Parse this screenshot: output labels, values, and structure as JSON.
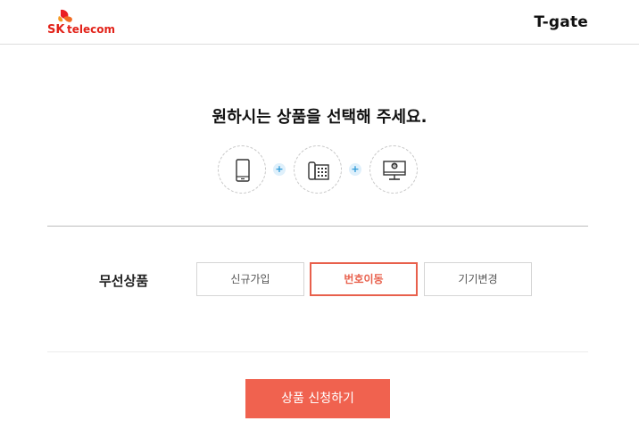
{
  "header": {
    "brand_sk": "SK",
    "brand_telecom": "telecom",
    "app_title": "T-gate"
  },
  "main": {
    "headline": "원하시는 상품을 선택해 주세요.",
    "product_icons": [
      "mobile-phone-icon",
      "landline-phone-icon",
      "tv-internet-icon"
    ],
    "plus_symbol": "+"
  },
  "wireless": {
    "section_label": "무선상품",
    "options": [
      {
        "label": "신규가입",
        "selected": false
      },
      {
        "label": "번호이동",
        "selected": true
      },
      {
        "label": "기기변경",
        "selected": false
      }
    ]
  },
  "submit": {
    "label": "상품 신청하기"
  },
  "colors": {
    "accent": "#f0624f",
    "selected_border": "#e8604c",
    "plus_bg": "#dff0fb",
    "plus_fg": "#2d9ad8"
  }
}
